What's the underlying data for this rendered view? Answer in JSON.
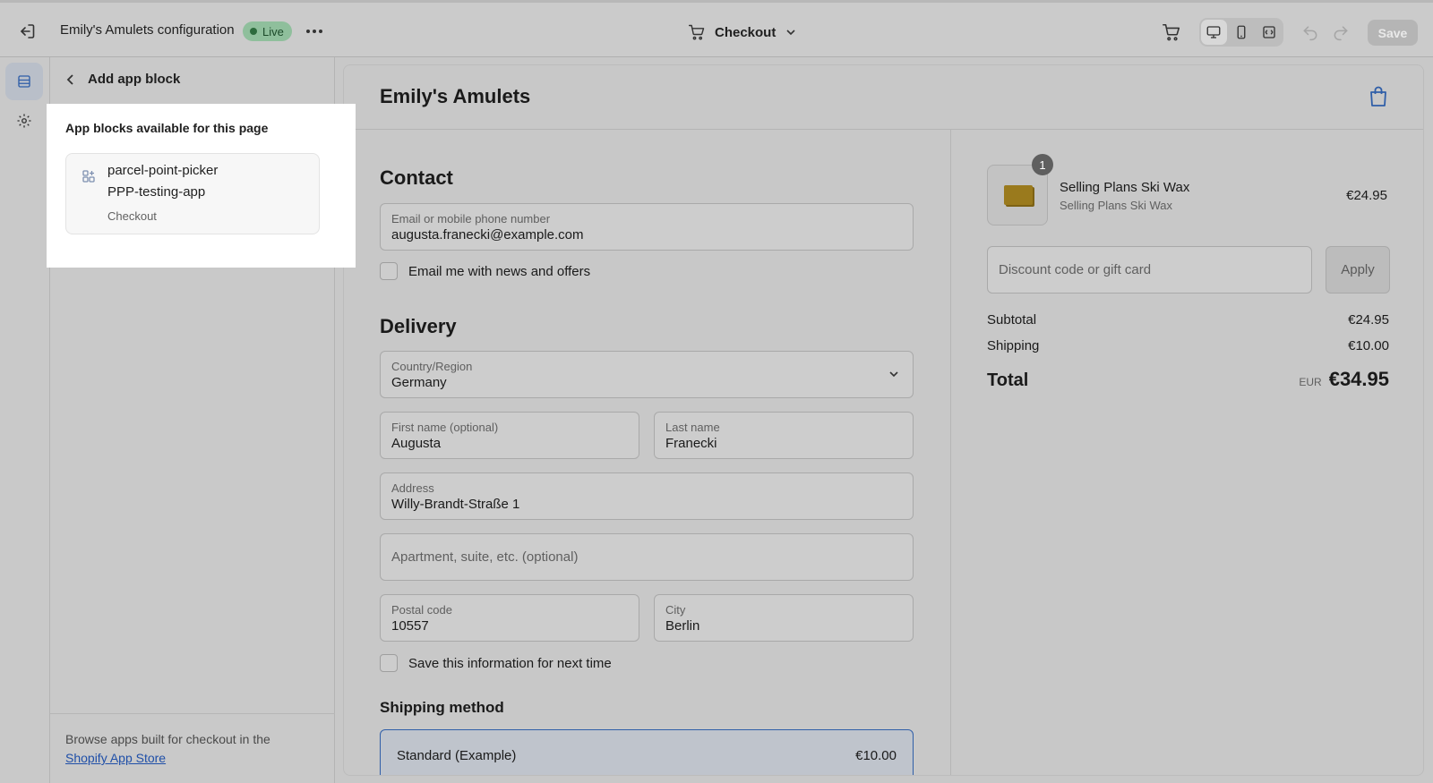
{
  "topbar": {
    "title": "Emily's Amulets configuration",
    "status": "Live",
    "page_selector": "Checkout",
    "save_label": "Save"
  },
  "panel": {
    "back_title": "Add app block",
    "footer_text": "Browse apps built for checkout in the",
    "footer_link": "Shopify App Store"
  },
  "app_blocks": {
    "heading": "App blocks available for this page",
    "items": [
      {
        "name": "parcel-point-picker",
        "app": "PPP-testing-app",
        "target": "Checkout"
      }
    ]
  },
  "checkout": {
    "shop_name": "Emily's Amulets",
    "contact": {
      "heading": "Contact",
      "email_label": "Email or mobile phone number",
      "email_value": "augusta.franecki@example.com",
      "newsletter_label": "Email me with news and offers"
    },
    "delivery": {
      "heading": "Delivery",
      "country_label": "Country/Region",
      "country_value": "Germany",
      "first_name_label": "First name (optional)",
      "first_name_value": "Augusta",
      "last_name_label": "Last name",
      "last_name_value": "Franecki",
      "address_label": "Address",
      "address_value": "Willy-Brandt-Straße 1",
      "apartment_placeholder": "Apartment, suite, etc. (optional)",
      "postal_label": "Postal code",
      "postal_value": "10557",
      "city_label": "City",
      "city_value": "Berlin",
      "save_info_label": "Save this information for next time"
    },
    "shipping": {
      "heading": "Shipping method",
      "option_name": "Standard (Example)",
      "option_price": "€10.00"
    }
  },
  "summary": {
    "item": {
      "quantity": "1",
      "name": "Selling Plans Ski Wax",
      "variant": "Selling Plans Ski Wax",
      "price": "€24.95"
    },
    "discount_placeholder": "Discount code or gift card",
    "apply_label": "Apply",
    "subtotal_label": "Subtotal",
    "subtotal_value": "€24.95",
    "shipping_label": "Shipping",
    "shipping_value": "€10.00",
    "total_label": "Total",
    "total_currency": "EUR",
    "total_value": "€34.95"
  },
  "colors": {
    "live_badge": "#8fbf9c",
    "accent": "#2f5ea8",
    "link": "#1f4fa8"
  }
}
